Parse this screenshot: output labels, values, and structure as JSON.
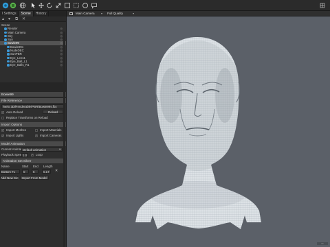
{
  "toolbar": {
    "icons": [
      "app-logo-icon",
      "viewport-icon",
      "globe-icon",
      "pointer-icon",
      "move-icon",
      "rotate-icon",
      "scale-icon",
      "frame-icon",
      "lasso-icon",
      "circle-select-icon",
      "speech-icon",
      "grid-icon"
    ]
  },
  "left_panel": {
    "tabs": [
      "l Settings",
      "Scene",
      "History"
    ],
    "tree": [
      {
        "label": "Scene",
        "indent": 0
      },
      {
        "label": "Render",
        "indent": 1
      },
      {
        "label": "Main Camera",
        "indent": 1
      },
      {
        "label": "Sky",
        "indent": 1
      },
      {
        "label": "Sun",
        "indent": 1
      },
      {
        "label": "Bowie99",
        "indent": 1,
        "selected": true
      },
      {
        "label": "Bowie99s",
        "indent": 2
      },
      {
        "label": "NudeDEC",
        "indent": 2
      },
      {
        "label": "SunPBR",
        "indent": 2
      },
      {
        "label": "Eye_Lens1",
        "indent": 2
      },
      {
        "label": "Eye_Ball_L1",
        "indent": 2
      },
      {
        "label": "Eye_Balls_R1",
        "indent": 2
      }
    ],
    "object_title": "Bowie99",
    "file_reference": {
      "header": "File Reference",
      "path": "/welo 3D/Renderable/PBR/Bowie99s.fbx",
      "auto_reload_label": "Auto Reload",
      "reload_button": "Reload",
      "replace_transforms": "Replace Transforms on Reload"
    },
    "import_options": {
      "header": "Import Options",
      "import_meshes": "Import Meshes",
      "import_materials": "Import Materials",
      "import_lights": "Import Lights",
      "import_cameras": "Import Cameras"
    },
    "model_animation": {
      "header": "Model Animation",
      "current_animation_label": "Current Animation:",
      "current_animation_value": "Default animation",
      "playback_speed_label": "Playback Speed",
      "playback_speed_value": "1.0",
      "loop_label": "Loop",
      "animation_list_header": "Animation Set Silver",
      "columns": [
        "Name",
        "Start",
        "End",
        "Length"
      ],
      "row": {
        "name": "Bottom #1",
        "start": "0",
        "end": "5",
        "length": "0.17"
      },
      "add_button": "Add New Set",
      "import_button": "Import From Model"
    }
  },
  "viewport": {
    "camera": "Main Camera",
    "quality": "Full Quality",
    "object": "wireframe human head bust",
    "background_color": "#5b6068",
    "mesh_color": "#d8dde1"
  }
}
